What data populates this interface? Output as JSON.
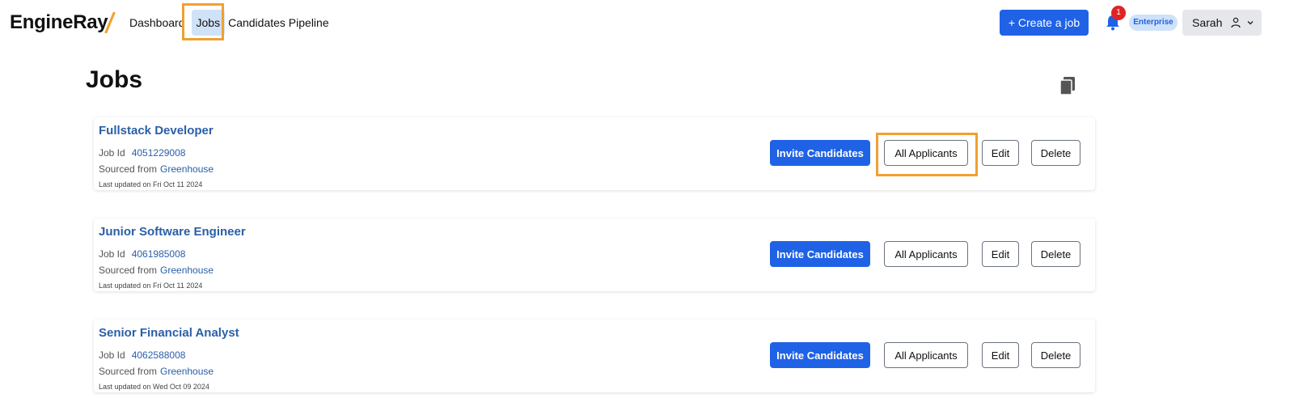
{
  "header": {
    "logo_text": "EngineRay",
    "nav": [
      "Dashboard",
      "Jobs",
      "Candidates Pipeline"
    ],
    "active_nav": "Jobs",
    "create_label": "+ Create a job",
    "notification_count": "1",
    "plan_badge": "Enterprise",
    "user_name": "Sarah"
  },
  "main": {
    "title": "Jobs",
    "jobs": [
      {
        "title": "Fullstack Developer",
        "job_id_label": "Job Id",
        "job_id": "4051229008",
        "sourced_label": "Sourced from",
        "source": "Greenhouse",
        "updated": "Last updated on Fri Oct 11 2024",
        "invite_label": "Invite Candidates",
        "applicants_label": "All Applicants",
        "edit_label": "Edit",
        "delete_label": "Delete"
      },
      {
        "title": "Junior Software Engineer",
        "job_id_label": "Job Id",
        "job_id": "4061985008",
        "sourced_label": "Sourced from",
        "source": "Greenhouse",
        "updated": "Last updated on Fri Oct 11 2024",
        "invite_label": "Invite Candidates",
        "applicants_label": "All Applicants",
        "edit_label": "Edit",
        "delete_label": "Delete"
      },
      {
        "title": "Senior Financial Analyst",
        "job_id_label": "Job Id",
        "job_id": "4062588008",
        "sourced_label": "Sourced from",
        "source": "Greenhouse",
        "updated": "Last updated on Wed Oct 09 2024",
        "invite_label": "Invite Candidates",
        "applicants_label": "All Applicants",
        "edit_label": "Edit",
        "delete_label": "Delete"
      }
    ]
  },
  "icons": {
    "bell": "bell-icon",
    "user": "user-icon",
    "chevron": "chevron-down-icon",
    "copy": "copy-icon"
  },
  "colors": {
    "primary": "#1f62e6",
    "link": "#2a5fa8",
    "nav_active_bg": "#cfe2f7",
    "highlight": "#f0a032",
    "badge_red": "#e02424"
  }
}
